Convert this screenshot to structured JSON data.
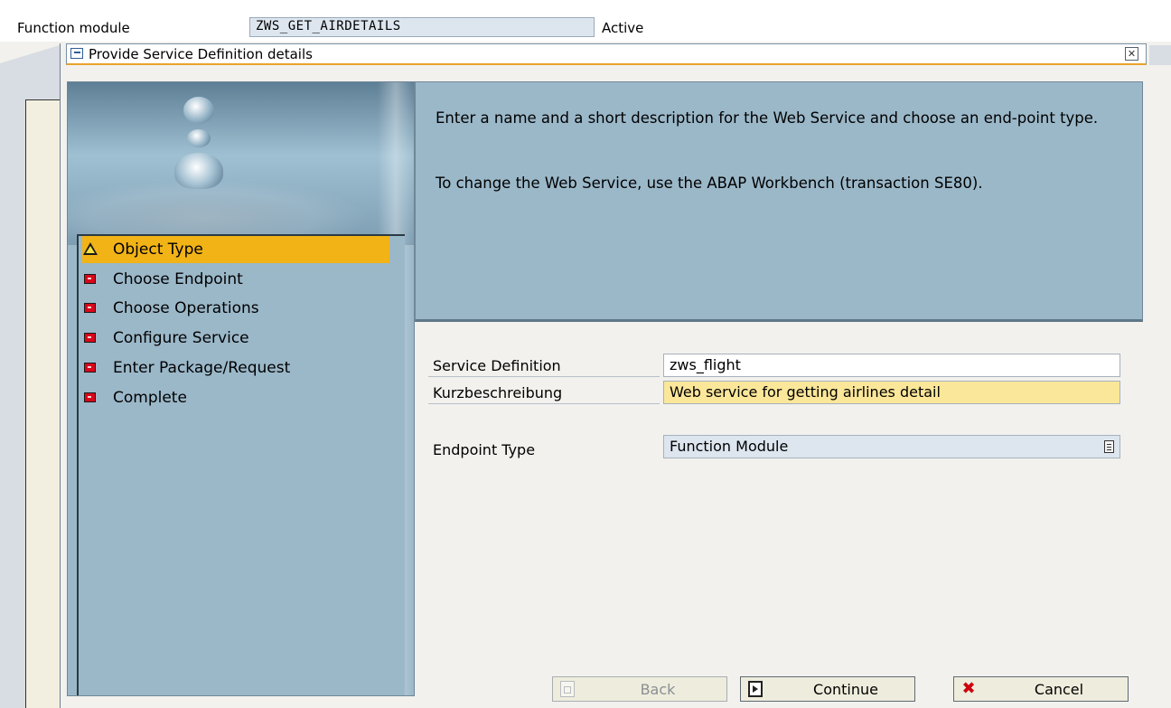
{
  "header": {
    "function_module_label": "Function module",
    "function_module_value": "ZWS_GET_AIRDETAILS",
    "status": "Active"
  },
  "dialog": {
    "title": "Provide Service Definition details",
    "close_icon": "close-icon"
  },
  "wizard": {
    "steps": [
      {
        "label": "Object Type",
        "status": "current",
        "icon": "warning-icon"
      },
      {
        "label": "Choose Endpoint",
        "status": "pending",
        "icon": "red-light-icon"
      },
      {
        "label": "Choose Operations",
        "status": "pending",
        "icon": "red-light-icon"
      },
      {
        "label": "Configure Service",
        "status": "pending",
        "icon": "red-light-icon"
      },
      {
        "label": "Enter Package/Request",
        "status": "pending",
        "icon": "red-light-icon"
      },
      {
        "label": "Complete",
        "status": "pending",
        "icon": "red-light-icon"
      }
    ]
  },
  "info": {
    "paragraph1": "Enter a name and a short description for the Web Service and choose an end-point type.",
    "paragraph2": "To change the Web Service, use the ABAP Workbench (transaction SE80)."
  },
  "form": {
    "service_definition_label": "Service Definition",
    "service_definition_value": "zws_flight",
    "short_description_label": "Kurzbeschreibung",
    "short_description_value": "Web service  for getting airlines detail",
    "endpoint_type_label": "Endpoint Type",
    "endpoint_type_value": "Function Module"
  },
  "buttons": {
    "back": "Back",
    "continue": "Continue",
    "cancel": "Cancel"
  },
  "colors": {
    "panel_blue": "#9bb8c9",
    "active_step": "#f2b317",
    "required_field": "#fbe79a",
    "step_error": "#d9061a"
  }
}
